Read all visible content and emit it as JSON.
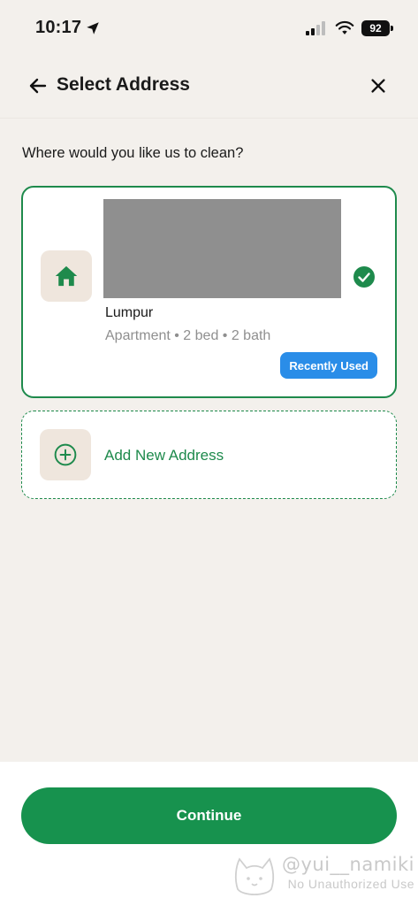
{
  "status_bar": {
    "time": "10:17",
    "battery": "92",
    "icons": [
      "location-arrow-icon",
      "signal-icon",
      "wifi-icon",
      "battery-icon"
    ]
  },
  "header": {
    "title": "Select Address",
    "back_icon": "arrow-left-icon",
    "close_icon": "close-icon"
  },
  "prompt": "Where would you like us to clean?",
  "address": {
    "icon": "home-icon",
    "name": "Lumpur",
    "details": "Apartment • 2 bed • 2 bath",
    "badge": "Recently Used",
    "selected": true
  },
  "add_address": {
    "icon": "plus-circle-icon",
    "label": "Add New Address"
  },
  "continue_label": "Continue",
  "watermark": {
    "handle": "@yui__namiki",
    "note": "No Unauthorized Use"
  },
  "colors": {
    "accent_green": "#1e8a4c",
    "button_green": "#17924e",
    "badge_blue": "#2a8de8",
    "background": "#f3f0ec",
    "tile": "#efe6dd"
  }
}
